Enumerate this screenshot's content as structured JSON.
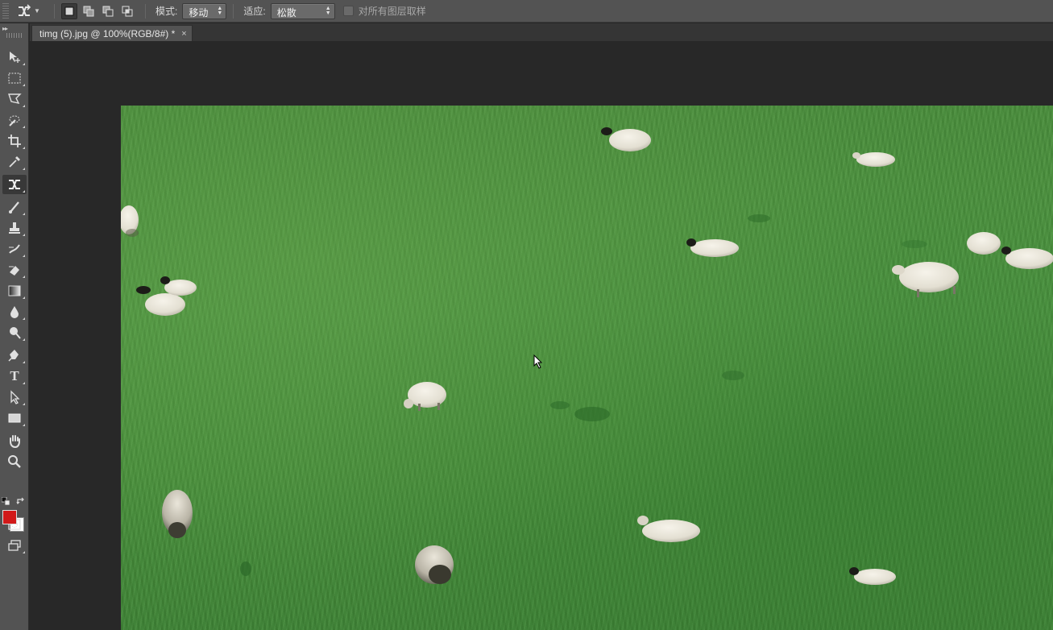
{
  "options_bar": {
    "mode_label": "模式:",
    "mode_value": "移动",
    "adapt_label": "适应:",
    "adapt_value": "松散",
    "sample_all_layers_label": "对所有图层取样"
  },
  "toolbar": {
    "text_tool_glyph": "T",
    "foreground_color": "#d11919",
    "background_color": "#ffffff"
  },
  "document": {
    "tab_title": "timg (5).jpg @ 100%(RGB/8#) *",
    "close_glyph": "×"
  }
}
